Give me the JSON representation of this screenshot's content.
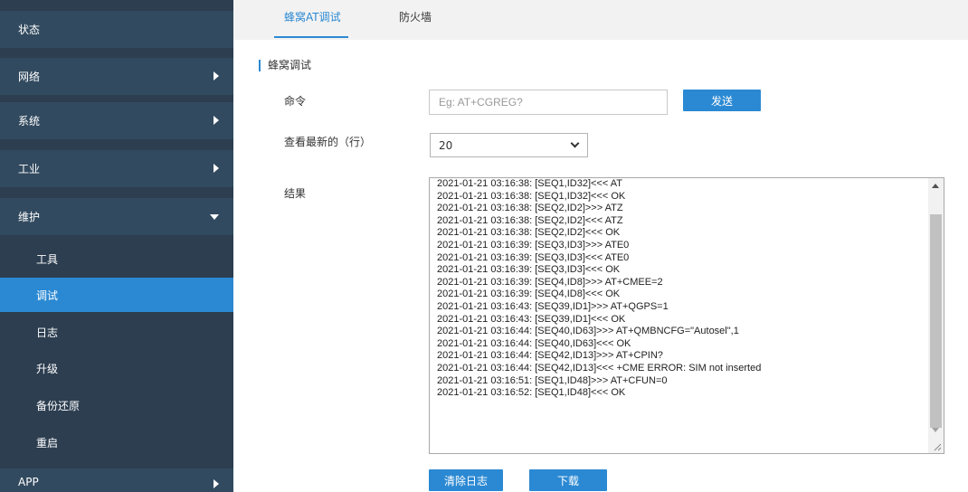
{
  "sidebar": {
    "items": [
      {
        "label": "状态"
      },
      {
        "label": "网络"
      },
      {
        "label": "系统"
      },
      {
        "label": "工业"
      },
      {
        "label": "维护"
      }
    ],
    "sub_items": [
      {
        "label": "工具"
      },
      {
        "label": "调试"
      },
      {
        "label": "日志"
      },
      {
        "label": "升级"
      },
      {
        "label": "备份还原"
      },
      {
        "label": "重启"
      }
    ],
    "app": {
      "label": "APP"
    }
  },
  "tabs": [
    {
      "label": "蜂窝AT调试"
    },
    {
      "label": "防火墙"
    }
  ],
  "section": {
    "title": "蜂窝调试"
  },
  "form": {
    "command_label": "命令",
    "command_placeholder": "Eg: AT+CGREG?",
    "send_label": "发送",
    "latest_label": "查看最新的（行）",
    "latest_value": "20",
    "result_label": "结果"
  },
  "log_lines": [
    "2021-01-21 03:16:38: [SEQ1,ID32]<<< AT",
    "2021-01-21 03:16:38: [SEQ1,ID32]<<< OK",
    "2021-01-21 03:16:38: [SEQ2,ID2]>>> ATZ",
    "2021-01-21 03:16:38: [SEQ2,ID2]<<< ATZ",
    "2021-01-21 03:16:38: [SEQ2,ID2]<<< OK",
    "2021-01-21 03:16:39: [SEQ3,ID3]>>> ATE0",
    "2021-01-21 03:16:39: [SEQ3,ID3]<<< ATE0",
    "2021-01-21 03:16:39: [SEQ3,ID3]<<< OK",
    "2021-01-21 03:16:39: [SEQ4,ID8]>>> AT+CMEE=2",
    "2021-01-21 03:16:39: [SEQ4,ID8]<<< OK",
    "2021-01-21 03:16:43: [SEQ39,ID1]>>> AT+QGPS=1",
    "2021-01-21 03:16:43: [SEQ39,ID1]<<< OK",
    "2021-01-21 03:16:44: [SEQ40,ID63]>>> AT+QMBNCFG=\"Autosel\",1",
    "2021-01-21 03:16:44: [SEQ40,ID63]<<< OK",
    "2021-01-21 03:16:44: [SEQ42,ID13]>>> AT+CPIN?",
    "2021-01-21 03:16:44: [SEQ42,ID13]<<< +CME ERROR: SIM not inserted",
    "2021-01-21 03:16:51: [SEQ1,ID48]>>> AT+CFUN=0",
    "2021-01-21 03:16:52: [SEQ1,ID48]<<< OK"
  ],
  "actions": {
    "clear_label": "清除日志",
    "download_label": "下载"
  },
  "colors": {
    "sidebar_bg": "#2c3e50",
    "sidebar_item_bg": "#324a5f",
    "accent": "#2b89d3"
  }
}
